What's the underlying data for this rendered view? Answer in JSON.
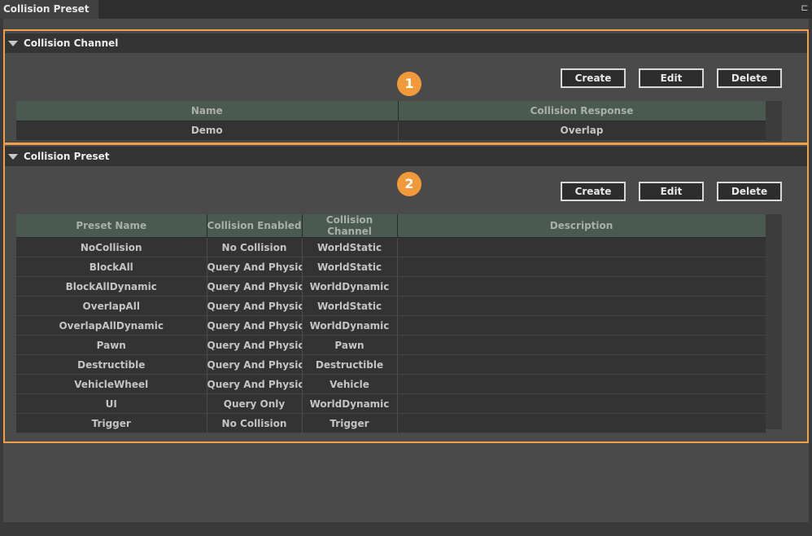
{
  "window": {
    "tab_title": "Collision Preset",
    "dock_icon": "dock-icon",
    "dock_glyph": "⊏"
  },
  "callouts": {
    "one": "1",
    "two": "2"
  },
  "accent_color": "#f0a04a",
  "collision_channel": {
    "title": "Collision Channel",
    "buttons": {
      "create": "Create",
      "edit": "Edit",
      "delete": "Delete"
    },
    "columns": [
      "Name",
      "Collision Response"
    ],
    "rows": [
      {
        "name": "Demo",
        "response": "Overlap"
      }
    ]
  },
  "collision_preset": {
    "title": "Collision Preset",
    "buttons": {
      "create": "Create",
      "edit": "Edit",
      "delete": "Delete"
    },
    "columns": [
      "Preset Name",
      "Collision Enabled",
      "Collision Channel",
      "Description"
    ],
    "rows": [
      {
        "name": "NoCollision",
        "enabled": "No Collision",
        "channel": "WorldStatic",
        "description": ""
      },
      {
        "name": "BlockAll",
        "enabled": "Query And Physics",
        "channel": "WorldStatic",
        "description": ""
      },
      {
        "name": "BlockAllDynamic",
        "enabled": "Query And Physics",
        "channel": "WorldDynamic",
        "description": ""
      },
      {
        "name": "OverlapAll",
        "enabled": "Query And Physics",
        "channel": "WorldStatic",
        "description": ""
      },
      {
        "name": "OverlapAllDynamic",
        "enabled": "Query And Physics",
        "channel": "WorldDynamic",
        "description": ""
      },
      {
        "name": "Pawn",
        "enabled": "Query And Physics",
        "channel": "Pawn",
        "description": ""
      },
      {
        "name": "Destructible",
        "enabled": "Query And Physics",
        "channel": "Destructible",
        "description": ""
      },
      {
        "name": "VehicleWheel",
        "enabled": "Query And Physics",
        "channel": "Vehicle",
        "description": ""
      },
      {
        "name": "UI",
        "enabled": "Query Only",
        "channel": "WorldDynamic",
        "description": ""
      },
      {
        "name": "Trigger",
        "enabled": "No Collision",
        "channel": "Trigger",
        "description": ""
      }
    ]
  }
}
